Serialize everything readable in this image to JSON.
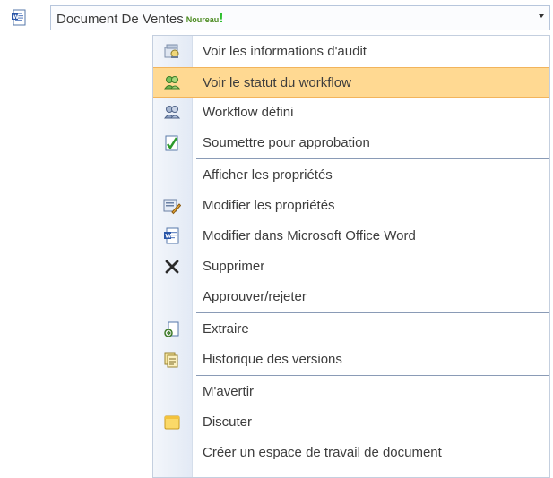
{
  "document": {
    "icon": "word-document-icon",
    "title": "Document De Ventes",
    "new_badge": "Noureau",
    "new_mark": "!"
  },
  "menu": {
    "items": [
      {
        "label": "Voir les informations d'audit",
        "icon": "audit-icon",
        "highlighted": false
      },
      {
        "label": "Voir le statut du workflow",
        "icon": "workflow-status-icon",
        "highlighted": true
      },
      {
        "label": "Workflow défini",
        "icon": "workflow-icon",
        "highlighted": false
      },
      {
        "label": "Soumettre pour approbation",
        "icon": "approval-icon",
        "highlighted": false
      },
      {
        "label": "Afficher les propriétés",
        "icon": "",
        "highlighted": false
      },
      {
        "label": "Modifier les propriétés",
        "icon": "edit-properties-icon",
        "highlighted": false
      },
      {
        "label": "Modifier dans Microsoft Office Word",
        "icon": "word-edit-icon",
        "highlighted": false
      },
      {
        "label": "Supprimer",
        "icon": "delete-icon",
        "highlighted": false
      },
      {
        "label": "Approuver/rejeter",
        "icon": "",
        "highlighted": false
      },
      {
        "label": "Extraire",
        "icon": "checkout-icon",
        "highlighted": false
      },
      {
        "label": "Historique des versions",
        "icon": "version-history-icon",
        "highlighted": false
      },
      {
        "label": "M'avertir",
        "icon": "",
        "highlighted": false
      },
      {
        "label": "Discuter",
        "icon": "discuss-icon",
        "highlighted": false
      },
      {
        "label": "Créer un espace de travail de document",
        "icon": "",
        "highlighted": false
      }
    ]
  },
  "colors": {
    "highlight_bg": "#ffd992",
    "highlight_border": "#f2b45c",
    "gutter": "#e8eef7",
    "text": "#3d3d3d"
  }
}
